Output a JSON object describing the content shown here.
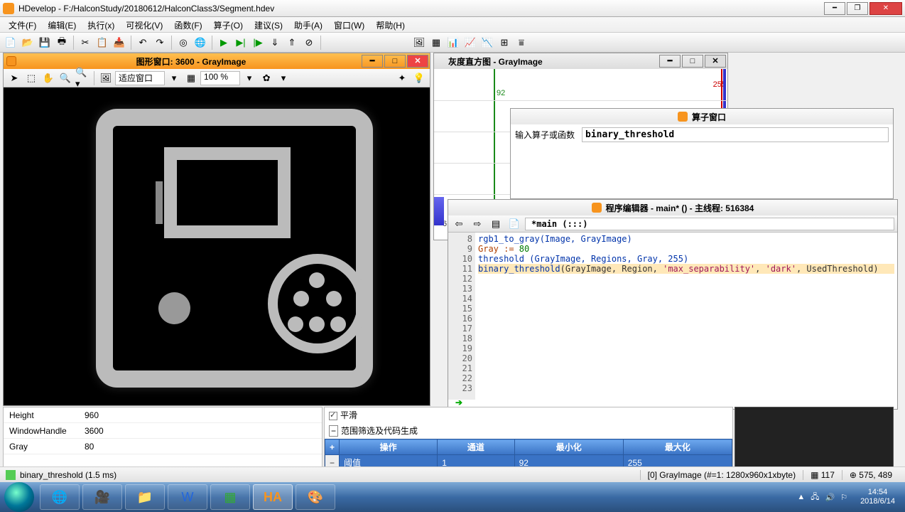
{
  "app": {
    "title": "HDevelop - F:/HalconStudy/20180612/HalconClass3/Segment.hdev"
  },
  "menu": {
    "file": "文件(F)",
    "edit": "编辑(E)",
    "exec": "执行(x)",
    "visual": "可视化(V)",
    "func": "函数(F)",
    "operator": "算子(O)",
    "suggest": "建议(S)",
    "asst": "助手(A)",
    "window": "窗口(W)",
    "help": "帮助(H)"
  },
  "graphics": {
    "title": "图形窗口: 3600 - GrayImage",
    "fit_label": "适应窗口",
    "zoom": "100 %"
  },
  "histogram": {
    "title": "灰度直方图 - GrayImage",
    "tick_left": "92",
    "tick_right": "255",
    "bottom": "6"
  },
  "operator": {
    "title": "算子窗口",
    "label": "输入算子或函数",
    "value": "binary_threshold"
  },
  "editor": {
    "title": "程序编辑器 - main* () - 主线程: 516384",
    "path": "*main (:::)",
    "lines": {
      "n8": "8",
      "n9": "9",
      "n10": "10",
      "n11": "11",
      "n12": "12",
      "n13": "13",
      "n14": "14",
      "n15": "15",
      "n16": "16",
      "n17": "17",
      "n18": "18",
      "n19": "19",
      "n20": "20",
      "n21": "21",
      "n22": "22",
      "n23": "23"
    },
    "code": {
      "l9": "rgb1_to_gray(Image, GrayImage)",
      "l12_pre": "Gray := ",
      "l12_val": "80",
      "l14": "threshold (GrayImage, Regions, Gray, 255)",
      "l16_fn": "binary_threshold",
      "l16_args": "(GrayImage, Region, ",
      "l16_s1": "'max_separability'",
      "l16_c1": ", ",
      "l16_s2": "'dark'",
      "l16_end": ", UsedThreshold)"
    }
  },
  "vars": [
    {
      "k": "Height",
      "v": "960"
    },
    {
      "k": "WindowHandle",
      "v": "3600"
    },
    {
      "k": "Gray",
      "v": "80"
    }
  ],
  "smooth": {
    "label": "平滑"
  },
  "range": {
    "title": "范围筛选及代码生成",
    "cols": {
      "op": "操作",
      "ch": "通道",
      "min": "最小化",
      "max": "最大化"
    },
    "row": {
      "op": "阈值",
      "ch": "1",
      "min": "92",
      "max": "255"
    }
  },
  "status": {
    "left": "binary_threshold (1.5 ms)",
    "gray": "[0] GrayImage (#=1: 1280x960x1xbyte)",
    "gval": "117",
    "coord": "575, 489"
  },
  "tray": {
    "time": "14:54",
    "date": "2018/6/14"
  }
}
